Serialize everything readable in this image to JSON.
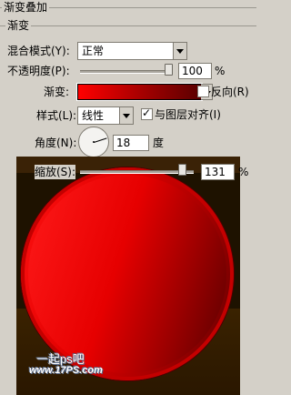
{
  "panel": {
    "outer_title": "渐变叠加",
    "inner_title": "渐变"
  },
  "blend_mode": {
    "label": "混合模式(Y):",
    "value": "正常"
  },
  "opacity": {
    "label": "不透明度(P):",
    "value": "100",
    "unit": "%",
    "level_percent": 100
  },
  "gradient": {
    "label": "渐变:",
    "reverse_label": "反向(R)",
    "reverse_checked": false,
    "colors": [
      "#ff0000",
      "#a00000",
      "#5a0000"
    ]
  },
  "style": {
    "label": "样式(L):",
    "value": "线性",
    "align_label": "与图层对齐(I)",
    "align_checked": true
  },
  "angle": {
    "label": "角度(N):",
    "value": "18",
    "unit": "度"
  },
  "scale": {
    "label": "缩放(S):",
    "value": "131",
    "unit": "%",
    "level_percent": 131
  },
  "watermark": {
    "line1": "一起ps吧",
    "line2": "www.17PS.com"
  },
  "icons": {
    "dropdown": "chevron-down-icon",
    "slider": "slider-thumb-icon",
    "angle": "angle-dial-icon"
  }
}
